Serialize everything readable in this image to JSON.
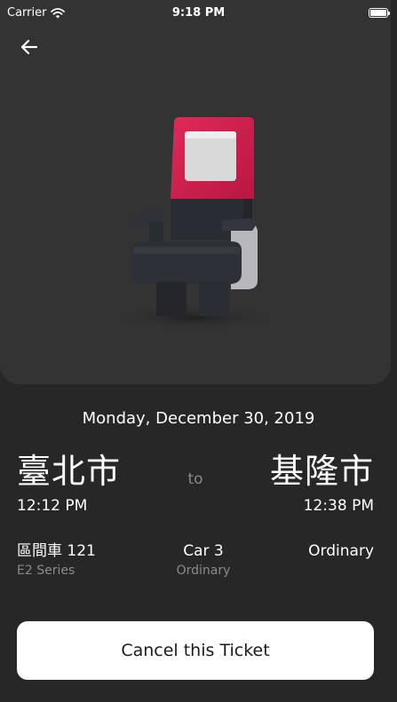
{
  "status_bar": {
    "carrier": "Carrier",
    "time": "9:18 PM"
  },
  "icons": {
    "back": "arrow-left-icon",
    "wifi": "wifi-icon",
    "battery": "battery-icon",
    "seat": "train-seat-icon"
  },
  "colors": {
    "background": "#272727",
    "card": "#333333",
    "seat_accent": "#d61d4f",
    "button_bg": "#ffffff",
    "muted_text": "#8b8b8b"
  },
  "ticket": {
    "date": "Monday, December 30, 2019",
    "from_station": "臺北市",
    "to_station": "基隆市",
    "to_label": "to",
    "depart_time": "12:12 PM",
    "arrive_time": "12:38 PM",
    "train_name": "區間車 121",
    "train_series": "E2 Series",
    "car": "Car 3",
    "car_class": "Ordinary",
    "ticket_class": "Ordinary"
  },
  "actions": {
    "cancel_label": "Cancel this Ticket"
  }
}
